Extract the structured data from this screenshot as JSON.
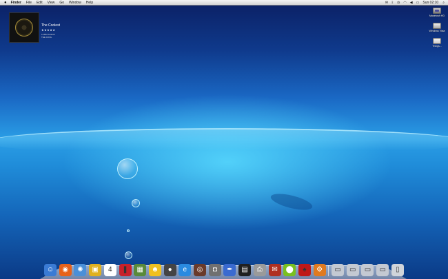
{
  "menubar": {
    "apple": "",
    "items": [
      "Finder",
      "File",
      "Edit",
      "View",
      "Go",
      "Window",
      "Help"
    ],
    "clock": "Sun 02:10"
  },
  "itunes_widget": {
    "track": "The Coolest",
    "stars": "★★★★★",
    "artist_line1": "LUPE FIASCO",
    "artist_line2": "THE COOL"
  },
  "desktop_icons": [
    {
      "label": "Macintosh HD",
      "icon": "hard-drive-icon"
    },
    {
      "label": "Windows Vista",
      "icon": "external-drive-icon"
    },
    {
      "label": "Things...",
      "icon": "things-app-icon"
    }
  ],
  "dock": {
    "apps": [
      {
        "name": "finder",
        "color": "#3a7bd5",
        "glyph": "☺"
      },
      {
        "name": "firefox",
        "color": "#e8621a",
        "glyph": "◉"
      },
      {
        "name": "safari",
        "color": "#4a8fd8",
        "glyph": "✺"
      },
      {
        "name": "stickies",
        "color": "#e0b020",
        "glyph": "▣"
      },
      {
        "name": "ical",
        "color": "#ffffff",
        "glyph": "4"
      },
      {
        "name": "thermometer",
        "color": "#c8202a",
        "glyph": "❚"
      },
      {
        "name": "iphoto",
        "color": "#5a8a3a",
        "glyph": "▦"
      },
      {
        "name": "adium",
        "color": "#f0c020",
        "glyph": "☻"
      },
      {
        "name": "frontrow",
        "color": "#444444",
        "glyph": "●"
      },
      {
        "name": "ie",
        "color": "#2a8ae0",
        "glyph": "e"
      },
      {
        "name": "photo-booth",
        "color": "#6a3a2a",
        "glyph": "◎"
      },
      {
        "name": "camera",
        "color": "#707070",
        "glyph": "◘"
      },
      {
        "name": "feather-pen",
        "color": "#3a6ad0",
        "glyph": "✒"
      },
      {
        "name": "activity",
        "color": "#202020",
        "glyph": "▤"
      },
      {
        "name": "printer",
        "color": "#9a9a9a",
        "glyph": "⎙"
      },
      {
        "name": "mail-stamp",
        "color": "#b03020",
        "glyph": "✉"
      },
      {
        "name": "lime-app",
        "color": "#7ac020",
        "glyph": "⬤"
      },
      {
        "name": "red-lamp",
        "color": "#c01818",
        "glyph": "♠"
      },
      {
        "name": "preferences",
        "color": "#e07a20",
        "glyph": "⚙"
      }
    ],
    "folders": [
      {
        "name": "applications-folder",
        "color": "#c4c9d2",
        "glyph": "▭"
      },
      {
        "name": "documents-folder",
        "color": "#c4c9d2",
        "glyph": "▭"
      },
      {
        "name": "downloads-folder",
        "color": "#c4c9d2",
        "glyph": "▭"
      },
      {
        "name": "music-folder",
        "color": "#c4c9d2",
        "glyph": "▭"
      },
      {
        "name": "trash",
        "color": "#d0d4da",
        "glyph": "▯"
      }
    ]
  }
}
